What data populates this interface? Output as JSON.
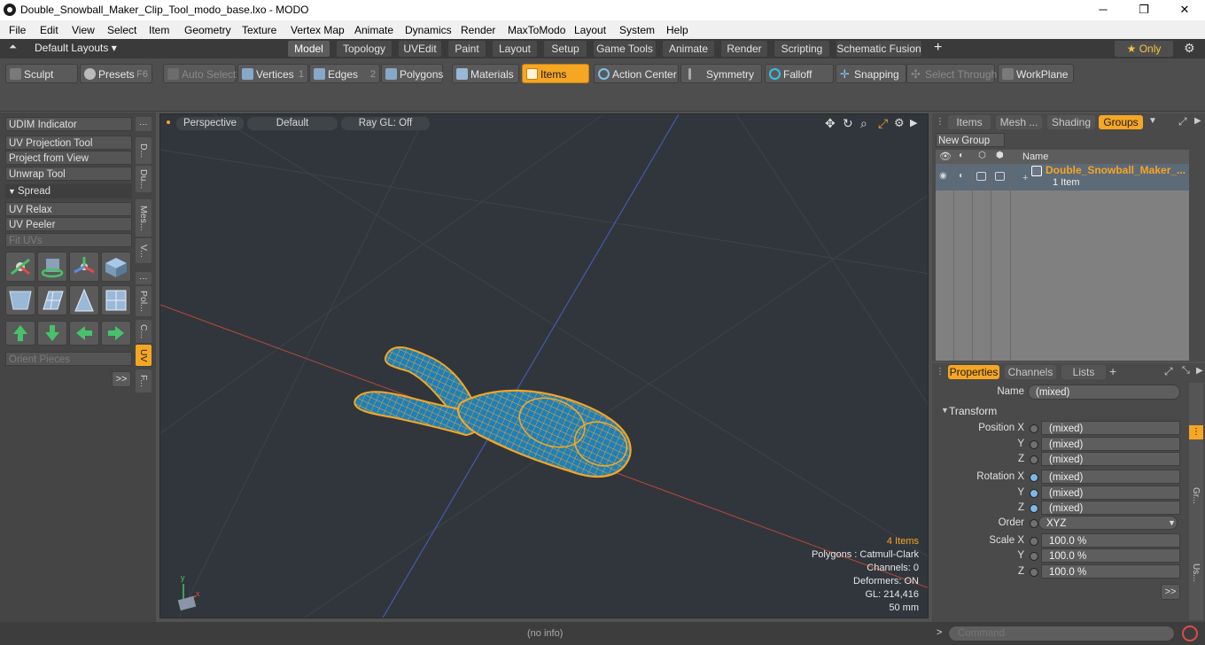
{
  "window": {
    "title": "Double_Snowball_Maker_Clip_Tool_modo_base.lxo - MODO",
    "minimize": "─",
    "maximize": "❐",
    "close": "✕"
  },
  "menu": [
    "File",
    "Edit",
    "View",
    "Select",
    "Item",
    "Geometry",
    "Texture",
    "Vertex Map",
    "Animate",
    "Dynamics",
    "Render",
    "MaxToModo",
    "Layout",
    "System",
    "Help"
  ],
  "layouts": {
    "selector": "Default Layouts ▾",
    "tabs": [
      "Model",
      "Topology",
      "UVEdit",
      "Paint",
      "Layout",
      "Setup",
      "Game Tools",
      "Animate",
      "Render",
      "Scripting",
      "Schematic Fusion"
    ],
    "active": "Model",
    "add": "+",
    "only": "★  Only",
    "gear": "⚙"
  },
  "toolbar": {
    "sculpt": "Sculpt",
    "presets": "Presets",
    "presets_key": "F6",
    "auto_select": "Auto Select",
    "vertices": "Vertices",
    "vertices_num": "1",
    "edges": "Edges",
    "edges_num": "2",
    "polygons": "Polygons",
    "materials": "Materials",
    "items": "Items",
    "action_center": "Action Center",
    "symmetry": "Symmetry",
    "falloff": "Falloff",
    "snapping": "Snapping",
    "select_through": "Select Through",
    "workplane": "WorkPlane"
  },
  "left_panel": {
    "buttons": [
      "UDIM Indicator",
      "UV Projection Tool",
      "Project from View",
      "Unwrap Tool"
    ],
    "spread_header": "Spread",
    "buttons2": [
      "UV Relax",
      "UV Peeler",
      "Fit UVs"
    ],
    "orient_pieces": "Orient Pieces",
    "more": ">>",
    "vtabs": [
      "D...",
      "Du...",
      "Mes...",
      "V...",
      "Pol...",
      "C...",
      "UV",
      "F..."
    ]
  },
  "viewport": {
    "tabs": [
      "Perspective",
      "Default",
      "Ray GL: Off"
    ],
    "info": [
      "4 Items",
      "Polygons : Catmull-Clark",
      "Channels: 0",
      "Deformers: ON",
      "GL: 214,416",
      "50 mm"
    ]
  },
  "groups_panel": {
    "tabs": [
      "Items",
      "Mesh ...",
      "Shading",
      "Groups"
    ],
    "active_tab": "Groups",
    "new_group": "New Group",
    "column_name": "Name",
    "group_name": "Double_Snowball_Maker_...",
    "group_sub": "1 Item"
  },
  "properties": {
    "tabs": [
      "Properties",
      "Channels",
      "Lists"
    ],
    "add": "+",
    "name_label": "Name",
    "name_value": "(mixed)",
    "transform": "Transform",
    "rows": [
      {
        "label": "Position X",
        "value": "(mixed)"
      },
      {
        "label": "Y",
        "value": "(mixed)"
      },
      {
        "label": "Z",
        "value": "(mixed)"
      },
      {
        "label": "Rotation X",
        "value": "(mixed)"
      },
      {
        "label": "Y",
        "value": "(mixed)"
      },
      {
        "label": "Z",
        "value": "(mixed)"
      },
      {
        "label": "Order",
        "value": "XYZ"
      },
      {
        "label": "Scale X",
        "value": "100.0 %"
      },
      {
        "label": "Y",
        "value": "100.0 %"
      },
      {
        "label": "Z",
        "value": "100.0 %"
      }
    ],
    "more": ">>",
    "side_tabs": [
      "Gr...",
      "Us..."
    ]
  },
  "status": {
    "info": "(no info)",
    "command_prompt": ">",
    "command_placeholder": "Command"
  },
  "colors": {
    "accent": "#f5a623",
    "mesh": "#f5a623",
    "mesh_fill": "#1f7fb8"
  }
}
